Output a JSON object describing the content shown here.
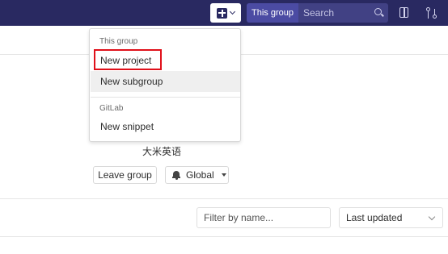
{
  "navbar": {
    "search_scope": "This group",
    "search_placeholder": "Search"
  },
  "new_menu": {
    "group_header": "This group",
    "items_group": [
      {
        "label": "New project",
        "highlighted_by_annotation": true
      },
      {
        "label": "New subgroup",
        "hovered": true
      }
    ],
    "gitlab_header": "GitLab",
    "items_gitlab": [
      {
        "label": "New snippet"
      }
    ],
    "annotation_color": "#e0101a"
  },
  "group": {
    "name": "大米英语",
    "leave_label": "Leave group",
    "notification_label": "Global"
  },
  "list_controls": {
    "filter_placeholder": "Filter by name...",
    "sort_label": "Last updated"
  },
  "colors": {
    "navbar": "#292961",
    "search_scope": "#4b4ba3",
    "search_field": "#414184"
  }
}
